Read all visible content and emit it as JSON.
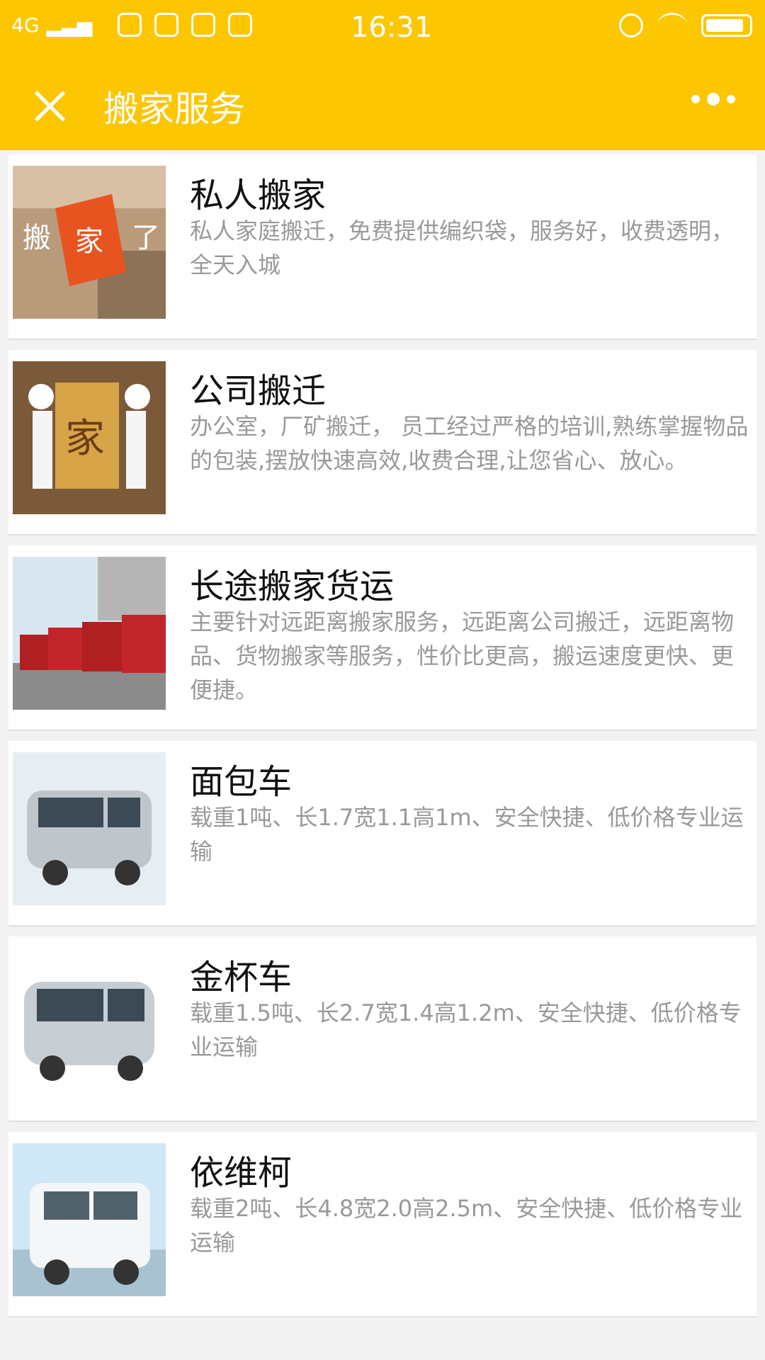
{
  "status_bar": {
    "network": "4G",
    "time": "16:31"
  },
  "navbar": {
    "title": "搬家服务"
  },
  "items": [
    {
      "name": "私人搬家",
      "desc": "私人家庭搬迁，免费提供编织袋，服务好，收费透明，全天入城"
    },
    {
      "name": "公司搬迁",
      "desc": "办公室，厂矿搬迁， 员工经过严格的培训,熟练掌握物品的包装,摆放快速高效,收费合理,让您省心、放心。"
    },
    {
      "name": "长途搬家货运",
      "desc": "主要针对远距离搬家服务，远距离公司搬迁，远距离物品、货物搬家等服务，性价比更高，搬运速度更快、更便捷。"
    },
    {
      "name": "面包车",
      "desc": "载重1吨、长1.7宽1.1高1m、安全快捷、低价格专业运输"
    },
    {
      "name": "金杯车",
      "desc": "载重1.5吨、长2.7宽1.4高1.2m、安全快捷、低价格专业运输"
    },
    {
      "name": "依维柯",
      "desc": "载重2吨、长4.8宽2.0高2.5m、安全快捷、低价格专业运输"
    }
  ],
  "thumbnail_text": {
    "item0": [
      "搬",
      "家",
      "了"
    ],
    "item1": "家"
  }
}
